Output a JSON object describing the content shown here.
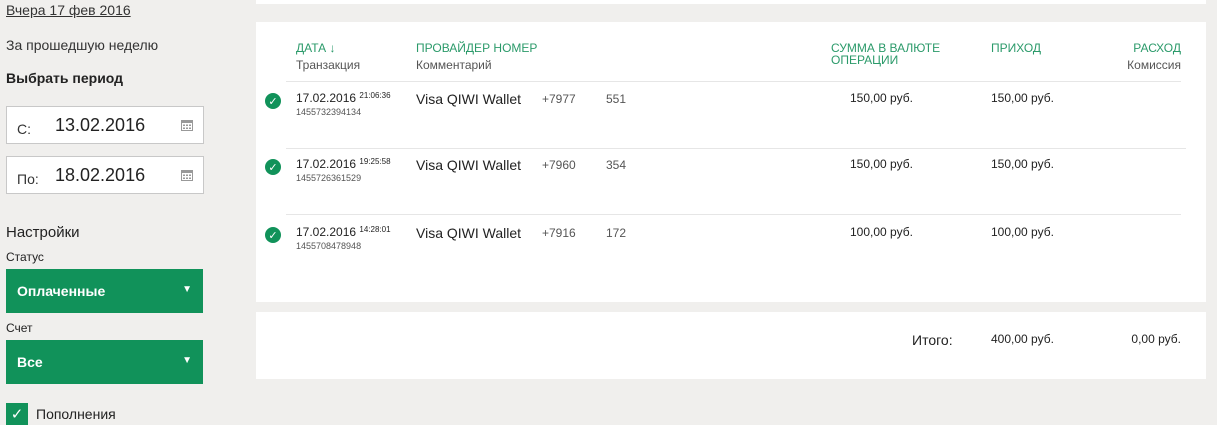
{
  "sidebar": {
    "yesterday_link": "Вчера 17 фев 2016",
    "last_week_link": "За прошедшую неделю",
    "period_title": "Выбрать период",
    "date_from": {
      "prefix": "С:",
      "value": "13.02.2016",
      "icon": "calendar-icon"
    },
    "date_to": {
      "prefix": "По:",
      "value": "18.02.2016",
      "icon": "calendar-icon"
    },
    "settings_title": "Настройки",
    "status_label": "Статус",
    "status_value": "Оплаченные",
    "account_label": "Счет",
    "account_value": "Все",
    "dropdown_arrow": "▼",
    "deposits_checkbox": {
      "label": "Пополнения",
      "checked": true,
      "mark": "✓"
    }
  },
  "table": {
    "headers": {
      "date": "Дата ↓",
      "date_sub": "Транзакция",
      "provider": "Провайдер Номер",
      "provider_sub": "Комментарий",
      "sum": "Сумма в валюте операции",
      "income": "Приход",
      "expense": "Расход",
      "expense_sub": "Комиссия"
    },
    "status_icon_mark": "✓",
    "rows": [
      {
        "date": "17.02.2016",
        "time": "21:06:36",
        "txid": "1455732394134",
        "provider": "Visa QIWI Wallet",
        "phone": "+7977",
        "phone_end": "551",
        "sum": "150,00 руб.",
        "income": "150,00 руб."
      },
      {
        "date": "17.02.2016",
        "time": "19:25:58",
        "txid": "1455726361529",
        "provider": "Visa QIWI Wallet",
        "phone": "+7960",
        "phone_end": "354",
        "sum": "150,00 руб.",
        "income": "150,00 руб."
      },
      {
        "date": "17.02.2016",
        "time": "14:28:01",
        "txid": "1455708478948",
        "provider": "Visa QIWI Wallet",
        "phone": "+7916",
        "phone_end": "172",
        "sum": "100,00 руб.",
        "income": "100,00 руб."
      }
    ]
  },
  "totals": {
    "label": "Итого:",
    "income": "400,00 руб.",
    "expense": "0,00 руб."
  },
  "colors": {
    "accent": "#11925a",
    "header_text": "#2b9a6a",
    "background": "#f0efed"
  }
}
